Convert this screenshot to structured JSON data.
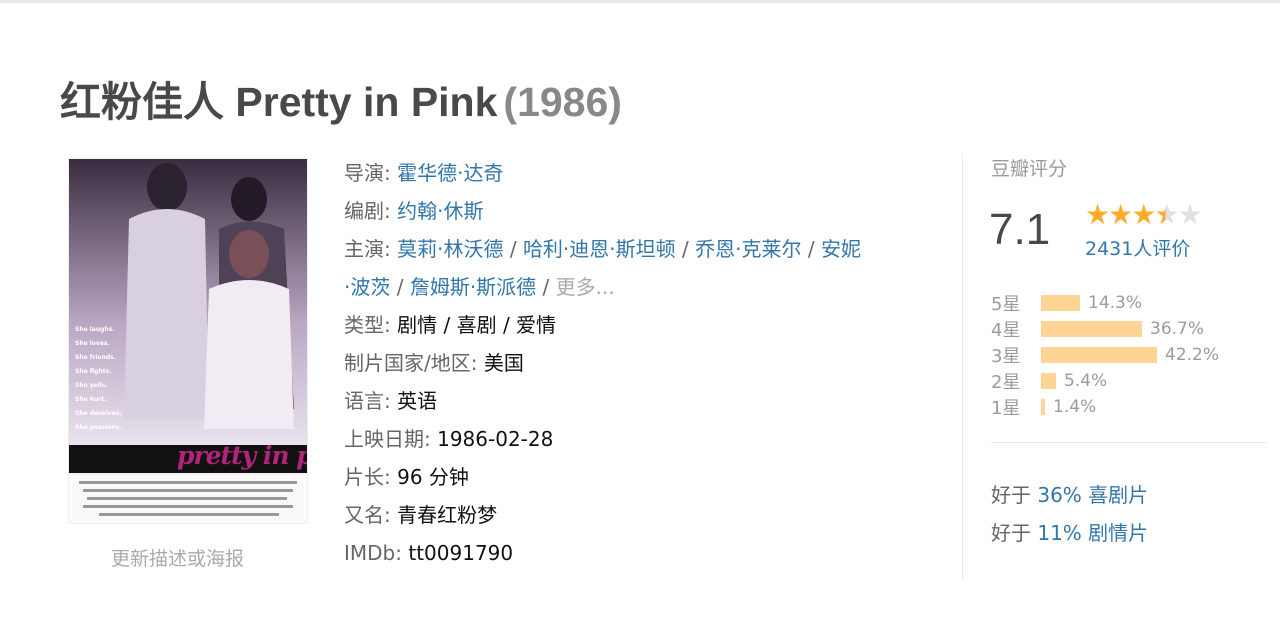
{
  "title": {
    "name": "红粉佳人 Pretty in Pink",
    "year": "(1986)"
  },
  "poster": {
    "film_name": "pretty in pink",
    "update_link": "更新描述或海报"
  },
  "info": {
    "director_label": "导演:",
    "director": "霍华德·达奇",
    "writer_label": "编剧:",
    "writer": "约翰·休斯",
    "cast_label": "主演:",
    "cast": [
      "莫莉·林沃德",
      "哈利·迪恩·斯坦顿",
      "乔恩·克莱尔",
      "安妮",
      "·波茨",
      "詹姆斯·斯派德"
    ],
    "cast_more": "更多...",
    "genre_label": "类型:",
    "genres": [
      "剧情",
      "喜剧",
      "爱情"
    ],
    "country_label": "制片国家/地区:",
    "country": "美国",
    "language_label": "语言:",
    "language": "英语",
    "release_label": "上映日期:",
    "release": "1986-02-28",
    "runtime_label": "片长:",
    "runtime": "96 分钟",
    "aka_label": "又名:",
    "aka": "青春红粉梦",
    "imdb_label": "IMDb:",
    "imdb": "tt0091790"
  },
  "rating": {
    "label": "豆瓣评分",
    "score": "7.1",
    "stars_value": 3.5,
    "votes": "2431人评价",
    "distribution": [
      {
        "star": "5星",
        "pct": "14.3%",
        "value": 14.3
      },
      {
        "star": "4星",
        "pct": "36.7%",
        "value": 36.7
      },
      {
        "star": "3星",
        "pct": "42.2%",
        "value": 42.2
      },
      {
        "star": "2星",
        "pct": "5.4%",
        "value": 5.4
      },
      {
        "star": "1星",
        "pct": "1.4%",
        "value": 1.4
      }
    ],
    "better_than": [
      {
        "prefix": "好于",
        "value": "36% 喜剧片"
      },
      {
        "prefix": "好于",
        "value": "11% 剧情片"
      }
    ]
  },
  "colors": {
    "link": "#3377aa",
    "star": "#ffac2d",
    "bar": "#ffd596",
    "title": "#494949"
  }
}
